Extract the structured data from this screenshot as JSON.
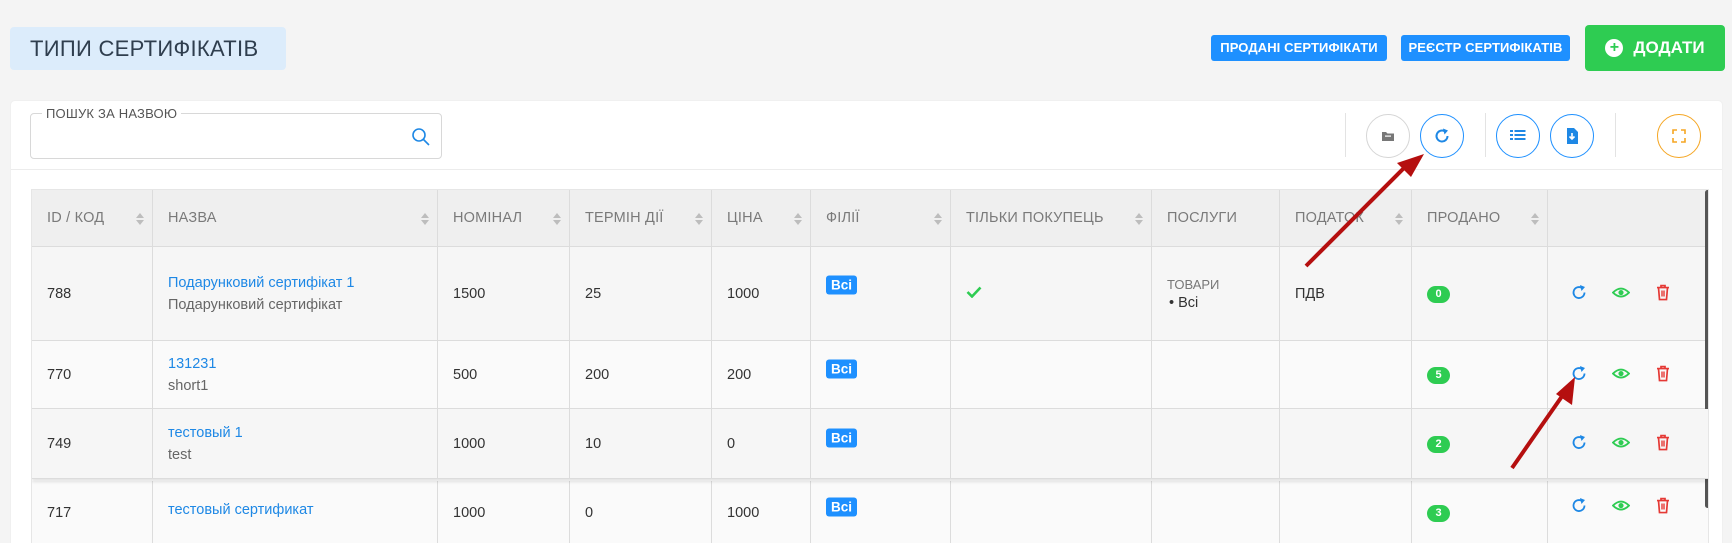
{
  "header": {
    "title": "ТИПИ СЕРТИФІКАТІВ",
    "sold_label": "ПРОДАНІ СЕРТИФІКАТИ",
    "registry_label": "РЕЄСТР СЕРТИФІКАТІВ",
    "add_label": "ДОДАТИ"
  },
  "search": {
    "label": "ПОШУК ЗА НАЗВОЮ",
    "value": ""
  },
  "columns": [
    "ID / КОД",
    "НАЗВА",
    "НОМІНАЛ",
    "ТЕРМІН ДІЇ",
    "ЦІНА",
    "ФІЛІЇ",
    "ТІЛЬКИ ПОКУПЕЦЬ",
    "ПОСЛУГИ",
    "ПОДАТОК",
    "ПРОДАНО"
  ],
  "rows": [
    {
      "id": "788",
      "name": "Подарунковий сертифікат 1",
      "subname": "Подарунковий сертифікат",
      "nominal": "1500",
      "term": "25",
      "price": "1000",
      "branches": "Всі",
      "buyer_only": true,
      "services_label": "ТОВАРИ",
      "services_item": "Всі",
      "tax": "ПДВ",
      "sold": "0"
    },
    {
      "id": "770",
      "name": "131231",
      "subname": "short1",
      "nominal": "500",
      "term": "200",
      "price": "200",
      "branches": "Всі",
      "buyer_only": false,
      "services_label": "",
      "services_item": "",
      "tax": "",
      "sold": "5"
    },
    {
      "id": "749",
      "name": "тестовый 1",
      "subname": "test",
      "nominal": "1000",
      "term": "10",
      "price": "0",
      "branches": "Всі",
      "buyer_only": false,
      "services_label": "",
      "services_item": "",
      "tax": "",
      "sold": "2"
    },
    {
      "id": "717",
      "name": "тестовый сертификат",
      "subname": "",
      "nominal": "1000",
      "term": "0",
      "price": "1000",
      "branches": "Всі",
      "buyer_only": false,
      "services_label": "",
      "services_item": "",
      "tax": "",
      "sold": "3"
    }
  ],
  "icons": {
    "search": "search-icon",
    "folder": "folder-icon",
    "refresh": "refresh-icon",
    "columns": "columns-icon",
    "export": "download-file-icon",
    "fullscreen": "fullscreen-icon",
    "check": "check-icon",
    "view": "eye-icon",
    "delete": "trash-icon",
    "add": "plus-circle-icon",
    "sort": "sort-icon",
    "annotation": "red-arrow-icon"
  },
  "colors": {
    "primary": "#1e90ff",
    "success": "#2ecc52",
    "danger": "#e53935",
    "warning": "#f5a623",
    "annotation": "#b50f0f"
  }
}
